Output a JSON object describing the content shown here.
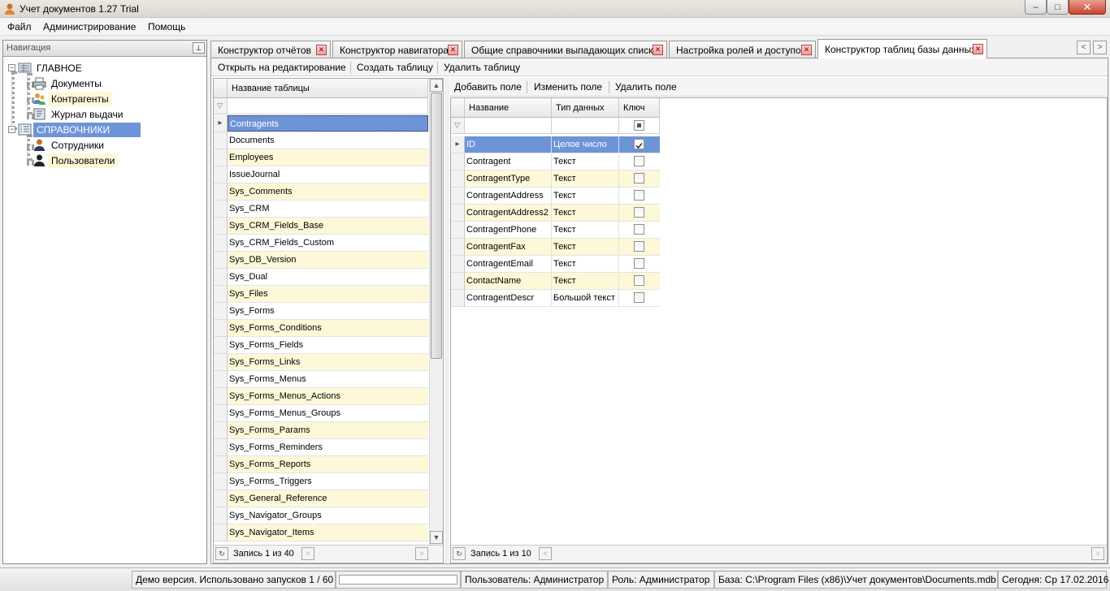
{
  "window": {
    "title": "Учет документов 1.27 Trial",
    "app_icon": "user-icon",
    "buttons": {
      "minimize": "–",
      "maximize": "□",
      "close": "✕"
    }
  },
  "menu": {
    "file": "Файл",
    "admin": "Администрирование",
    "help": "Помощь"
  },
  "navigation": {
    "title": "Навигация",
    "pin": "⊥",
    "groups": [
      {
        "label": "ГЛАВНОЕ",
        "items": [
          "Документы",
          "Контрагенты",
          "Журнал выдачи"
        ]
      },
      {
        "label": "СПРАВОЧНИКИ",
        "items": [
          "Сотрудники",
          "Пользователи"
        ]
      }
    ]
  },
  "tabs": [
    {
      "label": "Конструктор отчётов"
    },
    {
      "label": "Конструктор навигатора"
    },
    {
      "label": "Общие справочники выпадающих списков"
    },
    {
      "label": "Настройка ролей и доступов"
    },
    {
      "label": "Конструктор таблиц базы данных",
      "active": true
    }
  ],
  "tab_scroll": {
    "left": "<",
    "right": ">"
  },
  "toolbar_tables": {
    "open": "Открыть на редактирование",
    "create": "Создать таблицу",
    "delete": "Удалить таблицу"
  },
  "tables_grid": {
    "header": "Название таблицы",
    "rows": [
      "Contragents",
      "Documents",
      "Employees",
      "IssueJournal",
      "Sys_Comments",
      "Sys_CRM",
      "Sys_CRM_Fields_Base",
      "Sys_CRM_Fields_Custom",
      "Sys_DB_Version",
      "Sys_Dual",
      "Sys_Files",
      "Sys_Forms",
      "Sys_Forms_Conditions",
      "Sys_Forms_Fields",
      "Sys_Forms_Links",
      "Sys_Forms_Menus",
      "Sys_Forms_Menus_Actions",
      "Sys_Forms_Menus_Groups",
      "Sys_Forms_Params",
      "Sys_Forms_Reminders",
      "Sys_Forms_Reports",
      "Sys_Forms_Triggers",
      "Sys_General_Reference",
      "Sys_Navigator_Groups",
      "Sys_Navigator_Items"
    ],
    "record_label": "Запись 1 из 40"
  },
  "toolbar_fields": {
    "add": "Добавить поле",
    "edit": "Изменить поле",
    "delete": "Удалить поле"
  },
  "fields_grid": {
    "headers": [
      "Название",
      "Тип данных",
      "Ключ"
    ],
    "rows": [
      {
        "name": "ID",
        "type": "Целое число",
        "key": true
      },
      {
        "name": "Contragent",
        "type": "Текст",
        "key": false
      },
      {
        "name": "ContragentType",
        "type": "Текст",
        "key": false
      },
      {
        "name": "ContragentAddress",
        "type": "Текст",
        "key": false
      },
      {
        "name": "ContragentAddress2",
        "type": "Текст",
        "key": false
      },
      {
        "name": "ContragentPhone",
        "type": "Текст",
        "key": false
      },
      {
        "name": "ContragentFax",
        "type": "Текст",
        "key": false
      },
      {
        "name": "ContragentEmail",
        "type": "Текст",
        "key": false
      },
      {
        "name": "ContactName",
        "type": "Текст",
        "key": false
      },
      {
        "name": "ContragentDescr",
        "type": "Большой текст",
        "key": false
      }
    ],
    "record_label": "Запись 1 из 10"
  },
  "status": {
    "demo": "Демо версия. Использовано запусков 1 / 60",
    "user": "Пользователь: Администратор",
    "role": "Роль: Администратор",
    "db": "База: C:\\Program Files (x86)\\Учет документов\\Documents.mdb",
    "today": "Сегодня: Ср 17.02.2016"
  },
  "colors": {
    "selection": "#6e94d8",
    "alt_row": "#fdf8d8",
    "tab_close": "#c04040"
  }
}
